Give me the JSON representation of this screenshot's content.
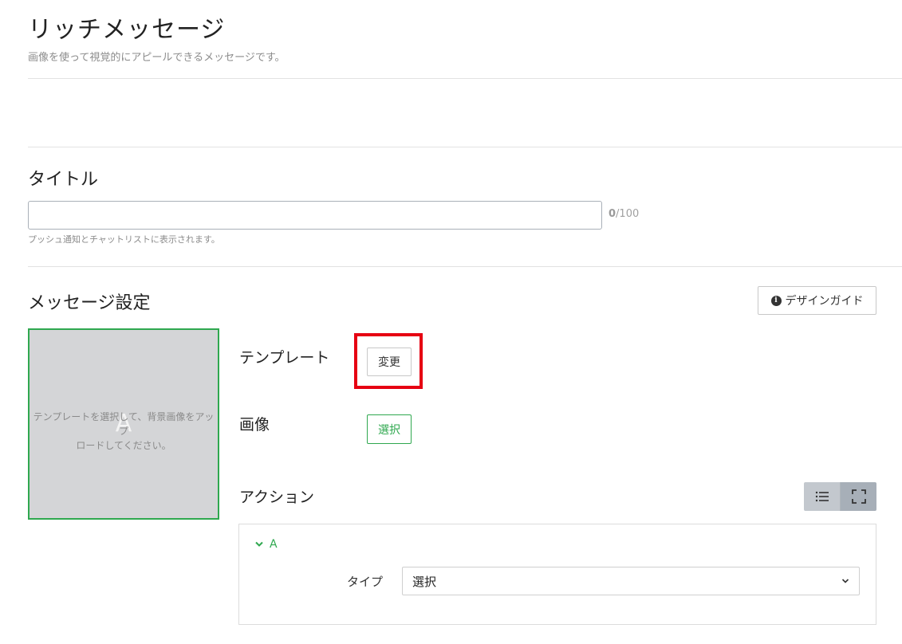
{
  "header": {
    "title": "リッチメッセージ",
    "subtitle": "画像を使って視覚的にアピールできるメッセージです。"
  },
  "title_section": {
    "heading": "タイトル",
    "input_value": "",
    "counter_current": "0",
    "counter_max": "/100",
    "help": "プッシュ通知とチャットリストに表示されます。"
  },
  "message_section": {
    "heading": "メッセージ設定",
    "design_guide_label": "デザインガイド",
    "preview": {
      "area_letter": "A",
      "placeholder": "テンプレートを選択して、背景画像をアップ\nロードしてください。"
    },
    "template": {
      "label": "テンプレート",
      "button_label": "変更"
    },
    "image": {
      "label": "画像",
      "button_label": "選択"
    },
    "action": {
      "label": "アクション",
      "area_name": "A",
      "type_label": "タイプ",
      "type_value": "選択"
    }
  },
  "colors": {
    "accent_green": "#2fa84f",
    "highlight_red": "#e60012"
  }
}
